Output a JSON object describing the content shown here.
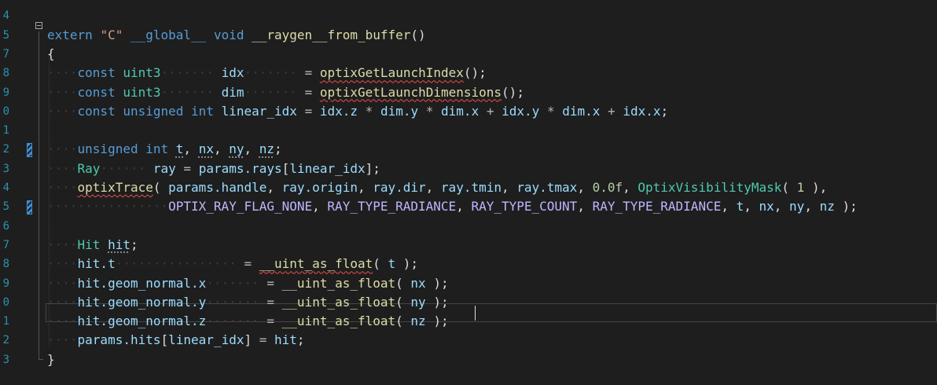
{
  "editor": {
    "line_numbers": [
      "4",
      "5",
      "7",
      "8",
      "9",
      "0",
      "1",
      "2",
      "3",
      "4",
      "5",
      "6",
      "7",
      "8",
      "9",
      "0",
      "1",
      "2",
      "3"
    ],
    "colors": {
      "background": "#1e1e1e",
      "keyword": "#569cd6",
      "type": "#4ec9b0",
      "function": "#dcdcaa",
      "variable": "#9cdcfe",
      "number": "#b5cea8",
      "string": "#d69d85",
      "macro": "#beb7ff",
      "line_number": "#2b91af"
    },
    "lines": [
      [],
      [
        [
          "kw",
          "extern"
        ],
        [
          "pl",
          " "
        ],
        [
          "str",
          "\"C\""
        ],
        [
          "pl",
          " "
        ],
        [
          "kw",
          "__global__"
        ],
        [
          "pl",
          " "
        ],
        [
          "kw",
          "void"
        ],
        [
          "pl",
          " "
        ],
        [
          "fn",
          "__raygen__from_buffer"
        ],
        [
          "pl",
          "()"
        ]
      ],
      [
        [
          "pl",
          "{"
        ]
      ],
      [
        [
          "ws",
          "····"
        ],
        [
          "kw",
          "const"
        ],
        [
          "pl",
          " "
        ],
        [
          "ty",
          "uint3"
        ],
        [
          "ws",
          "·······"
        ],
        [
          "pl",
          " "
        ],
        [
          "var",
          "idx"
        ],
        [
          "ws",
          "·······"
        ],
        [
          "pl",
          " "
        ],
        [
          "op",
          "="
        ],
        [
          "pl",
          " "
        ],
        [
          "fn",
          "optixGetLaunchIndex",
          "sq"
        ],
        [
          "pl",
          "();"
        ]
      ],
      [
        [
          "ws",
          "····"
        ],
        [
          "kw",
          "const"
        ],
        [
          "pl",
          " "
        ],
        [
          "ty",
          "uint3"
        ],
        [
          "ws",
          "·······"
        ],
        [
          "pl",
          " "
        ],
        [
          "var",
          "dim"
        ],
        [
          "ws",
          "·······"
        ],
        [
          "pl",
          " "
        ],
        [
          "op",
          "="
        ],
        [
          "pl",
          " "
        ],
        [
          "fn",
          "optixGetLaunchDimensions",
          "sq"
        ],
        [
          "pl",
          "();"
        ]
      ],
      [
        [
          "ws",
          "····"
        ],
        [
          "kw",
          "const"
        ],
        [
          "pl",
          " "
        ],
        [
          "kw",
          "unsigned"
        ],
        [
          "pl",
          " "
        ],
        [
          "kw",
          "int"
        ],
        [
          "pl",
          " "
        ],
        [
          "var",
          "linear_idx"
        ],
        [
          "pl",
          " "
        ],
        [
          "op",
          "="
        ],
        [
          "pl",
          " "
        ],
        [
          "var",
          "idx.z"
        ],
        [
          "pl",
          " "
        ],
        [
          "op",
          "*"
        ],
        [
          "pl",
          " "
        ],
        [
          "var",
          "dim.y"
        ],
        [
          "pl",
          " "
        ],
        [
          "op",
          "*"
        ],
        [
          "pl",
          " "
        ],
        [
          "var",
          "dim.x"
        ],
        [
          "pl",
          " "
        ],
        [
          "op",
          "+"
        ],
        [
          "pl",
          " "
        ],
        [
          "var",
          "idx.y"
        ],
        [
          "pl",
          " "
        ],
        [
          "op",
          "*"
        ],
        [
          "pl",
          " "
        ],
        [
          "var",
          "dim.x"
        ],
        [
          "pl",
          " "
        ],
        [
          "op",
          "+"
        ],
        [
          "pl",
          " "
        ],
        [
          "var",
          "idx.x"
        ],
        [
          "pl",
          ";"
        ]
      ],
      [],
      [
        [
          "ws",
          "····"
        ],
        [
          "kw",
          "unsigned"
        ],
        [
          "pl",
          " "
        ],
        [
          "kw",
          "int"
        ],
        [
          "pl",
          " "
        ],
        [
          "var",
          "t",
          "dot"
        ],
        [
          "pl",
          ", "
        ],
        [
          "var",
          "nx",
          "dot"
        ],
        [
          "pl",
          ", "
        ],
        [
          "var",
          "ny",
          "dot"
        ],
        [
          "pl",
          ", "
        ],
        [
          "var",
          "nz",
          "dot"
        ],
        [
          "pl",
          ";"
        ]
      ],
      [
        [
          "ws",
          "····"
        ],
        [
          "ty",
          "Ray"
        ],
        [
          "ws",
          "······"
        ],
        [
          "pl",
          " "
        ],
        [
          "var",
          "ray"
        ],
        [
          "pl",
          " "
        ],
        [
          "op",
          "="
        ],
        [
          "pl",
          " "
        ],
        [
          "var",
          "params.rays"
        ],
        [
          "pl",
          "["
        ],
        [
          "var",
          "linear_idx"
        ],
        [
          "pl",
          "];"
        ]
      ],
      [
        [
          "ws",
          "····"
        ],
        [
          "fn",
          "optixTrace",
          "sq"
        ],
        [
          "pl",
          "( "
        ],
        [
          "var",
          "params.handle"
        ],
        [
          "pl",
          ", "
        ],
        [
          "var",
          "ray.origin"
        ],
        [
          "pl",
          ", "
        ],
        [
          "var",
          "ray.dir"
        ],
        [
          "pl",
          ", "
        ],
        [
          "var",
          "ray.tmin"
        ],
        [
          "pl",
          ", "
        ],
        [
          "var",
          "ray.tmax"
        ],
        [
          "pl",
          ", "
        ],
        [
          "num",
          "0.0f"
        ],
        [
          "pl",
          ", "
        ],
        [
          "ty",
          "OptixVisibilityMask"
        ],
        [
          "pl",
          "( "
        ],
        [
          "num",
          "1"
        ],
        [
          "pl",
          " ),"
        ]
      ],
      [
        [
          "ws",
          "················"
        ],
        [
          "mac",
          "OPTIX_RAY_FLAG_NONE"
        ],
        [
          "pl",
          ", "
        ],
        [
          "mac",
          "RAY_TYPE_RADIANCE"
        ],
        [
          "pl",
          ", "
        ],
        [
          "mac",
          "RAY_TYPE_COUNT"
        ],
        [
          "pl",
          ", "
        ],
        [
          "mac",
          "RAY_TYPE_RADIANCE"
        ],
        [
          "pl",
          ", "
        ],
        [
          "var",
          "t"
        ],
        [
          "pl",
          ", "
        ],
        [
          "var",
          "nx"
        ],
        [
          "pl",
          ", "
        ],
        [
          "var",
          "ny"
        ],
        [
          "pl",
          ", "
        ],
        [
          "var",
          "nz"
        ],
        [
          "pl",
          " );"
        ]
      ],
      [],
      [
        [
          "ws",
          "····"
        ],
        [
          "ty",
          "Hit"
        ],
        [
          "pl",
          " "
        ],
        [
          "var",
          "hit",
          "dot"
        ],
        [
          "pl",
          ";"
        ]
      ],
      [
        [
          "ws",
          "····"
        ],
        [
          "var",
          "hit.t"
        ],
        [
          "ws",
          "················"
        ],
        [
          "pl",
          " "
        ],
        [
          "op",
          "="
        ],
        [
          "pl",
          " "
        ],
        [
          "fn",
          "__uint_as_float",
          "sq"
        ],
        [
          "pl",
          "( "
        ],
        [
          "var",
          "t"
        ],
        [
          "pl",
          " );"
        ]
      ],
      [
        [
          "ws",
          "····"
        ],
        [
          "var",
          "hit.geom_normal.x"
        ],
        [
          "ws",
          "·······"
        ],
        [
          "pl",
          " "
        ],
        [
          "op",
          "="
        ],
        [
          "pl",
          " "
        ],
        [
          "fn",
          "__uint_as_float"
        ],
        [
          "pl",
          "( "
        ],
        [
          "var",
          "nx"
        ],
        [
          "pl",
          " );"
        ]
      ],
      [
        [
          "ws",
          "····"
        ],
        [
          "var",
          "hit.geom_normal.y"
        ],
        [
          "ws",
          "·······"
        ],
        [
          "pl",
          " "
        ],
        [
          "op",
          "="
        ],
        [
          "pl",
          " "
        ],
        [
          "fn",
          "__uint_as_float"
        ],
        [
          "pl",
          "( "
        ],
        [
          "var",
          "ny"
        ],
        [
          "pl",
          " );"
        ]
      ],
      [
        [
          "ws",
          "····"
        ],
        [
          "var",
          "hit.geom_normal.z"
        ],
        [
          "ws",
          "·······"
        ],
        [
          "pl",
          " "
        ],
        [
          "op",
          "="
        ],
        [
          "pl",
          " "
        ],
        [
          "fn",
          "__uint_as_float"
        ],
        [
          "pl",
          "( "
        ],
        [
          "var",
          "nz"
        ],
        [
          "pl",
          " );"
        ]
      ],
      [
        [
          "ws",
          "····"
        ],
        [
          "var",
          "params.hits"
        ],
        [
          "pl",
          "["
        ],
        [
          "var",
          "linear_idx"
        ],
        [
          "pl",
          "] "
        ],
        [
          "op",
          "="
        ],
        [
          "pl",
          " "
        ],
        [
          "var",
          "hit"
        ],
        [
          "pl",
          ";"
        ]
      ],
      [
        [
          "pl",
          "}"
        ]
      ]
    ],
    "change_marker_lines": [
      7,
      10
    ]
  }
}
